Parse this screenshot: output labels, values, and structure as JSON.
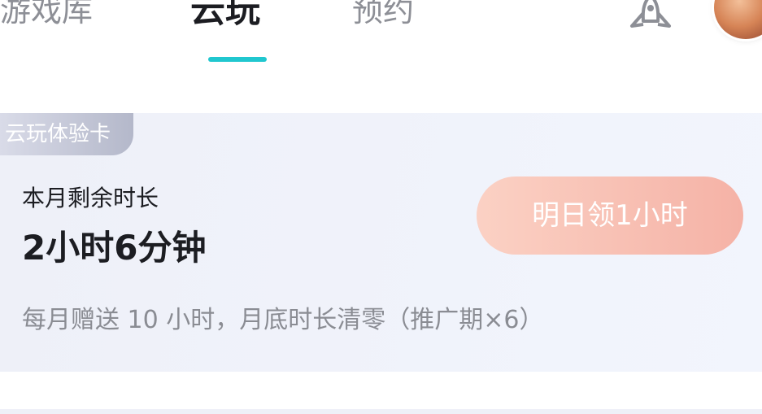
{
  "header": {
    "tabs": [
      {
        "label": "游戏库"
      },
      {
        "label": "云玩"
      },
      {
        "label": "预约"
      }
    ],
    "active_tab": "云玩",
    "indicator_color": "#20c7cf",
    "icons": [
      "rocket-icon"
    ],
    "avatar": "user-avatar"
  },
  "card": {
    "badge": "云玩体验卡",
    "remaining_label": "本月剩余时长",
    "remaining_value": "2小时6分钟",
    "claim_button_label": "明日领1小时",
    "note": "每月赠送 10 小时，月底时长清零（推广期×6）",
    "accent_button_color": "#f5b2a6"
  }
}
